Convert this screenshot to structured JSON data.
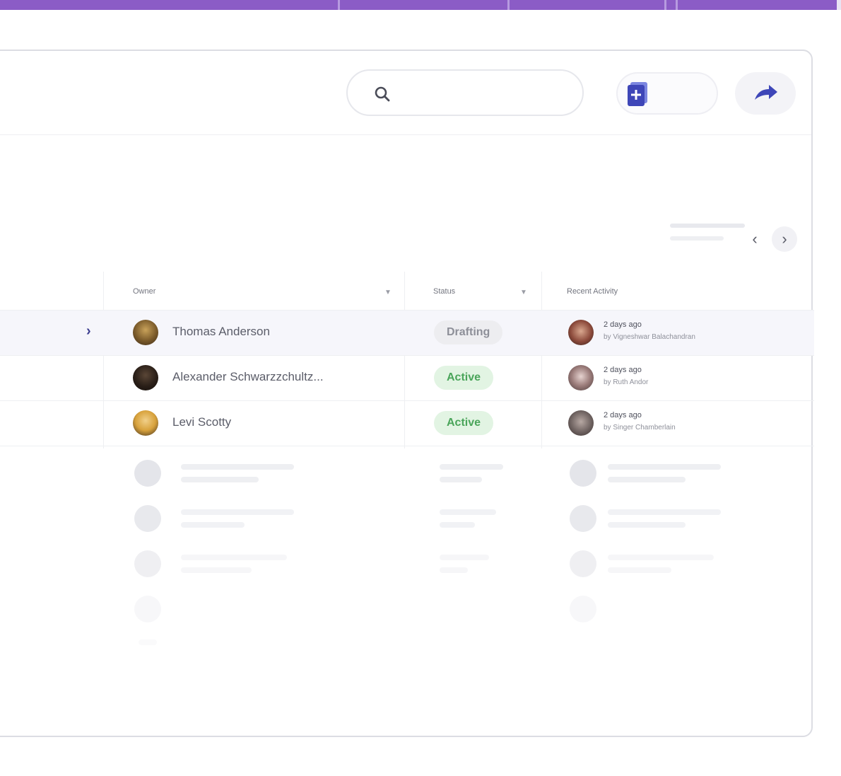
{
  "colors": {
    "topbar": "#8b5cc6",
    "accent": "#3d3f8f",
    "badge_active_bg": "#e2f4e3",
    "badge_active_text": "#4aa55a",
    "badge_drafting_bg": "#ededf0",
    "badge_drafting_text": "#8d8f98"
  },
  "search": {
    "placeholder": "",
    "icon": "search-icon"
  },
  "toolbar": {
    "new_document_icon": "new-document-icon",
    "share_icon": "share-icon"
  },
  "table": {
    "columns": {
      "owner": "Owner",
      "status": "Status",
      "recent_activity": "Recent Activity"
    },
    "rows": [
      {
        "owner": "Thomas Anderson",
        "status": "Drafting",
        "activity_when": "2 days ago",
        "activity_by": "by Vigneshwar Balachandran"
      },
      {
        "owner": "Alexander Schwarzzchultz...",
        "status": "Active",
        "activity_when": "2 days ago",
        "activity_by": "by Ruth Andor"
      },
      {
        "owner": "Levi Scotty",
        "status": "Active",
        "activity_when": "2 days ago",
        "activity_by": "by Singer Chamberlain"
      }
    ]
  },
  "pager": {
    "prev_glyph": "‹",
    "next_glyph": "›"
  }
}
